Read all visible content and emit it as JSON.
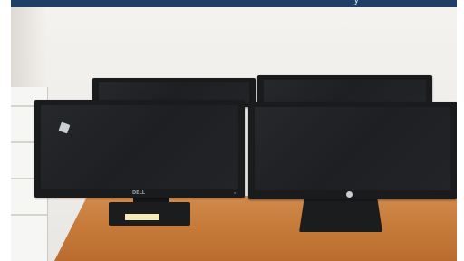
{
  "colors": {
    "banner": "#1f3f66",
    "wall": "#f1efec",
    "desk": "#c77c3c",
    "monitor_bezel": "#1a1b1d",
    "screen": "#222427"
  },
  "banner": {
    "glyph": "y"
  },
  "monitors": {
    "front_left_logo": "DELL",
    "front_right_logo": "hp-icon"
  }
}
